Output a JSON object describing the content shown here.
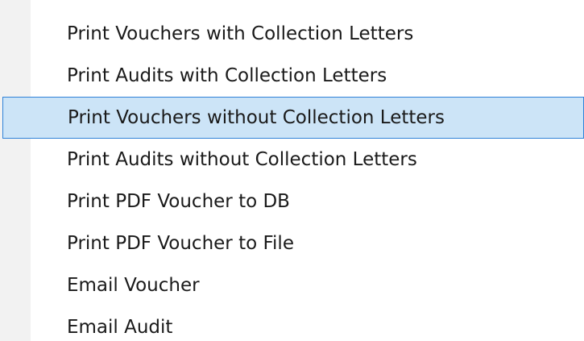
{
  "menu": {
    "items": [
      {
        "label": "Print Vouchers with Collection Letters",
        "highlighted": false
      },
      {
        "label": "Print Audits with Collection Letters",
        "highlighted": false
      },
      {
        "label": "Print Vouchers without Collection Letters",
        "highlighted": true
      },
      {
        "label": "Print Audits without Collection Letters",
        "highlighted": false
      },
      {
        "label": "Print PDF Voucher to DB",
        "highlighted": false
      },
      {
        "label": "Print PDF Voucher to File",
        "highlighted": false
      },
      {
        "label": "Email Voucher",
        "highlighted": false
      },
      {
        "label": "Email Audit",
        "highlighted": false
      }
    ]
  },
  "colors": {
    "highlight_background": "#cce4f7",
    "highlight_border": "#2f82d8",
    "gutter": "#f2f2f2",
    "text": "#1a1a1a"
  }
}
